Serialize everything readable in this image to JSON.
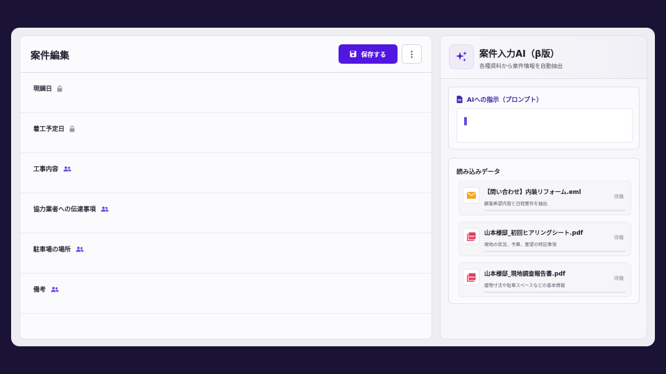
{
  "editor": {
    "title": "案件編集",
    "save_label": "保存する",
    "fields": [
      {
        "label": "現調日",
        "icon": "lock-icon"
      },
      {
        "label": "着工予定日",
        "icon": "lock-icon"
      },
      {
        "label": "工事内容",
        "icon": "people-icon"
      },
      {
        "label": "協力業者への伝達事項",
        "icon": "people-icon"
      },
      {
        "label": "駐車場の場所",
        "icon": "people-icon"
      },
      {
        "label": "備考",
        "icon": "people-icon"
      }
    ]
  },
  "ai_panel": {
    "title": "案件入力AI（β版）",
    "subtitle": "各種資料から案件情報を自動抽出",
    "prompt_title": "AIへの指示（プロンプト）",
    "data_title": "読み込みデータ",
    "files": [
      {
        "name": "【問い合わせ】内装リフォーム.eml",
        "desc": "顧客希望内容と日程要件を抽出",
        "status": "待機",
        "type": "mail-icon"
      },
      {
        "name": "山本様邸_初回ヒアリングシート.pdf",
        "desc": "現地の状況、予算、要望の特記事項",
        "status": "待機",
        "type": "pdf-icon"
      },
      {
        "name": "山本様邸_現地調査報告書.pdf",
        "desc": "建物寸法や駐車スペースなどの基本情報",
        "status": "待機",
        "type": "pdf-icon"
      }
    ]
  },
  "colors": {
    "accent": "#5116e0",
    "background": "#1a1336",
    "people_icon": "#6a3fe0",
    "lock_icon": "#9a98a6"
  }
}
